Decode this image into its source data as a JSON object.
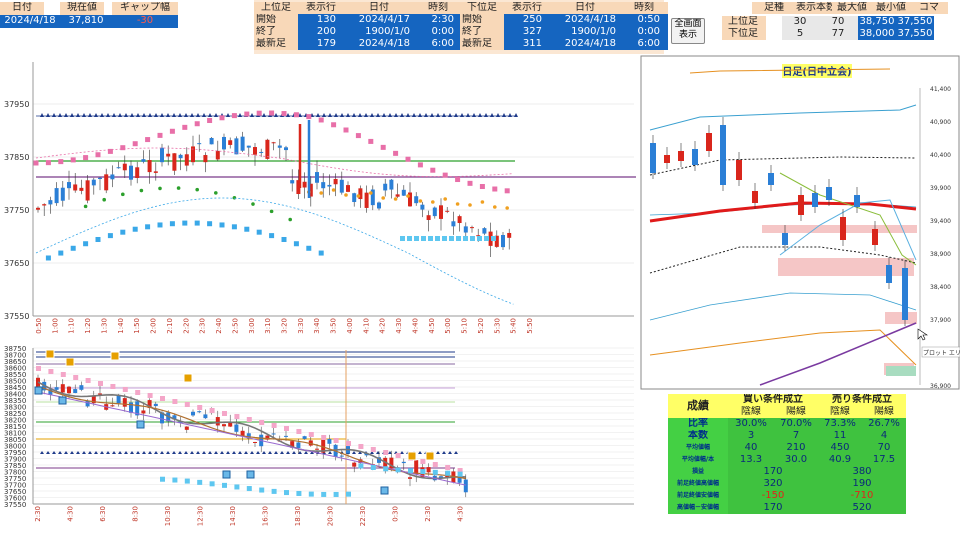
{
  "top_left": {
    "headers": [
      "日付",
      "現在値",
      "ギャップ幅"
    ],
    "values": [
      "2024/4/18",
      "37,810",
      "-30"
    ]
  },
  "upper_table": {
    "headers": [
      "上位足",
      "表示行",
      "日付",
      "時刻"
    ],
    "rows": [
      [
        "開始",
        "130",
        "2024/4/17",
        "2:30"
      ],
      [
        "終了",
        "200",
        "1900/1/0",
        "0:00"
      ],
      [
        "最新足",
        "179",
        "2024/4/18",
        "6:00"
      ]
    ]
  },
  "lower_table": {
    "headers": [
      "下位足",
      "表示行",
      "日付",
      "時刻"
    ],
    "rows": [
      [
        "開始",
        "250",
        "2024/4/18",
        "0:50"
      ],
      [
        "終了",
        "327",
        "1900/1/0",
        "0:00"
      ],
      [
        "最新足",
        "311",
        "2024/4/18",
        "6:00"
      ]
    ]
  },
  "full_screen_button": "全画面\n表示",
  "right_table": {
    "headers": [
      "足種",
      "表示本数",
      "最大値",
      "最小値",
      "コマ"
    ],
    "rows": [
      [
        "上位足",
        "30",
        "70",
        "38,750",
        "37,550"
      ],
      [
        "下位足",
        "5",
        "77",
        "38,000",
        "37,550"
      ]
    ]
  },
  "chart1": {
    "y_ticks": [
      "37950",
      "37850",
      "37750",
      "37650",
      "37550"
    ],
    "x_ticks": [
      "0:50",
      "1:00",
      "1:10",
      "1:20",
      "1:30",
      "1:40",
      "1:50",
      "2:00",
      "2:10",
      "2:20",
      "2:30",
      "2:40",
      "2:50",
      "3:00",
      "3:10",
      "3:20",
      "3:30",
      "3:40",
      "3:50",
      "4:00",
      "4:10",
      "4:20",
      "4:30",
      "4:40",
      "4:50",
      "5:00",
      "5:10",
      "5:20",
      "5:30",
      "5:40",
      "5:50"
    ]
  },
  "chart2": {
    "y_ticks": [
      "38750",
      "38700",
      "38650",
      "38600",
      "38550",
      "38500",
      "38450",
      "38400",
      "38350",
      "38300",
      "38250",
      "38200",
      "38150",
      "38100",
      "38050",
      "38000",
      "37950",
      "37900",
      "37850",
      "37800",
      "37750",
      "37700",
      "37650",
      "37600",
      "37550"
    ],
    "x_ticks": [
      "2:30",
      "4:30",
      "6:30",
      "8:30",
      "10:30",
      "12:30",
      "14:30",
      "16:30",
      "18:30",
      "20:30",
      "22:30",
      "0:30",
      "2:30",
      "4:30"
    ]
  },
  "daily_chart": {
    "title": "日足(日中立会)",
    "y_ticks": [
      "41,400",
      "40,900",
      "40,400",
      "39,900",
      "39,400",
      "38,900",
      "38,400",
      "37,900",
      "37,400",
      "36,900"
    ],
    "tooltip": "プロット エリア"
  },
  "stats": {
    "title": "成績",
    "col_headers": [
      "買い条件成立",
      "売り条件成立"
    ],
    "sub_headers": [
      "陰線",
      "陽線",
      "陰線",
      "陽線"
    ],
    "rows": [
      {
        "label": "比率",
        "vals": [
          "30.0%",
          "70.0%",
          "73.3%",
          "26.7%"
        ]
      },
      {
        "label": "本数",
        "vals": [
          "3",
          "7",
          "11",
          "4"
        ]
      },
      {
        "label": "平均値幅",
        "vals": [
          "40",
          "210",
          "450",
          "70"
        ]
      },
      {
        "label": "平均値幅/本",
        "vals": [
          "13.3",
          "30.0",
          "40.9",
          "17.5"
        ]
      },
      {
        "label": "損益",
        "vals": [
          "170",
          "380"
        ]
      },
      {
        "label": "前足終値高値幅",
        "vals": [
          "320",
          "190"
        ]
      },
      {
        "label": "前足終値安値幅",
        "vals": [
          "-150",
          "-710"
        ]
      },
      {
        "label": "高値幅－安値幅",
        "vals": [
          "170",
          "520"
        ]
      }
    ]
  },
  "colors": {
    "blue_header": "#1565c0",
    "up": "#2b7fd6",
    "down": "#d9261c",
    "accent_green": "#44d044",
    "accent_yellow": "#ffff66"
  }
}
